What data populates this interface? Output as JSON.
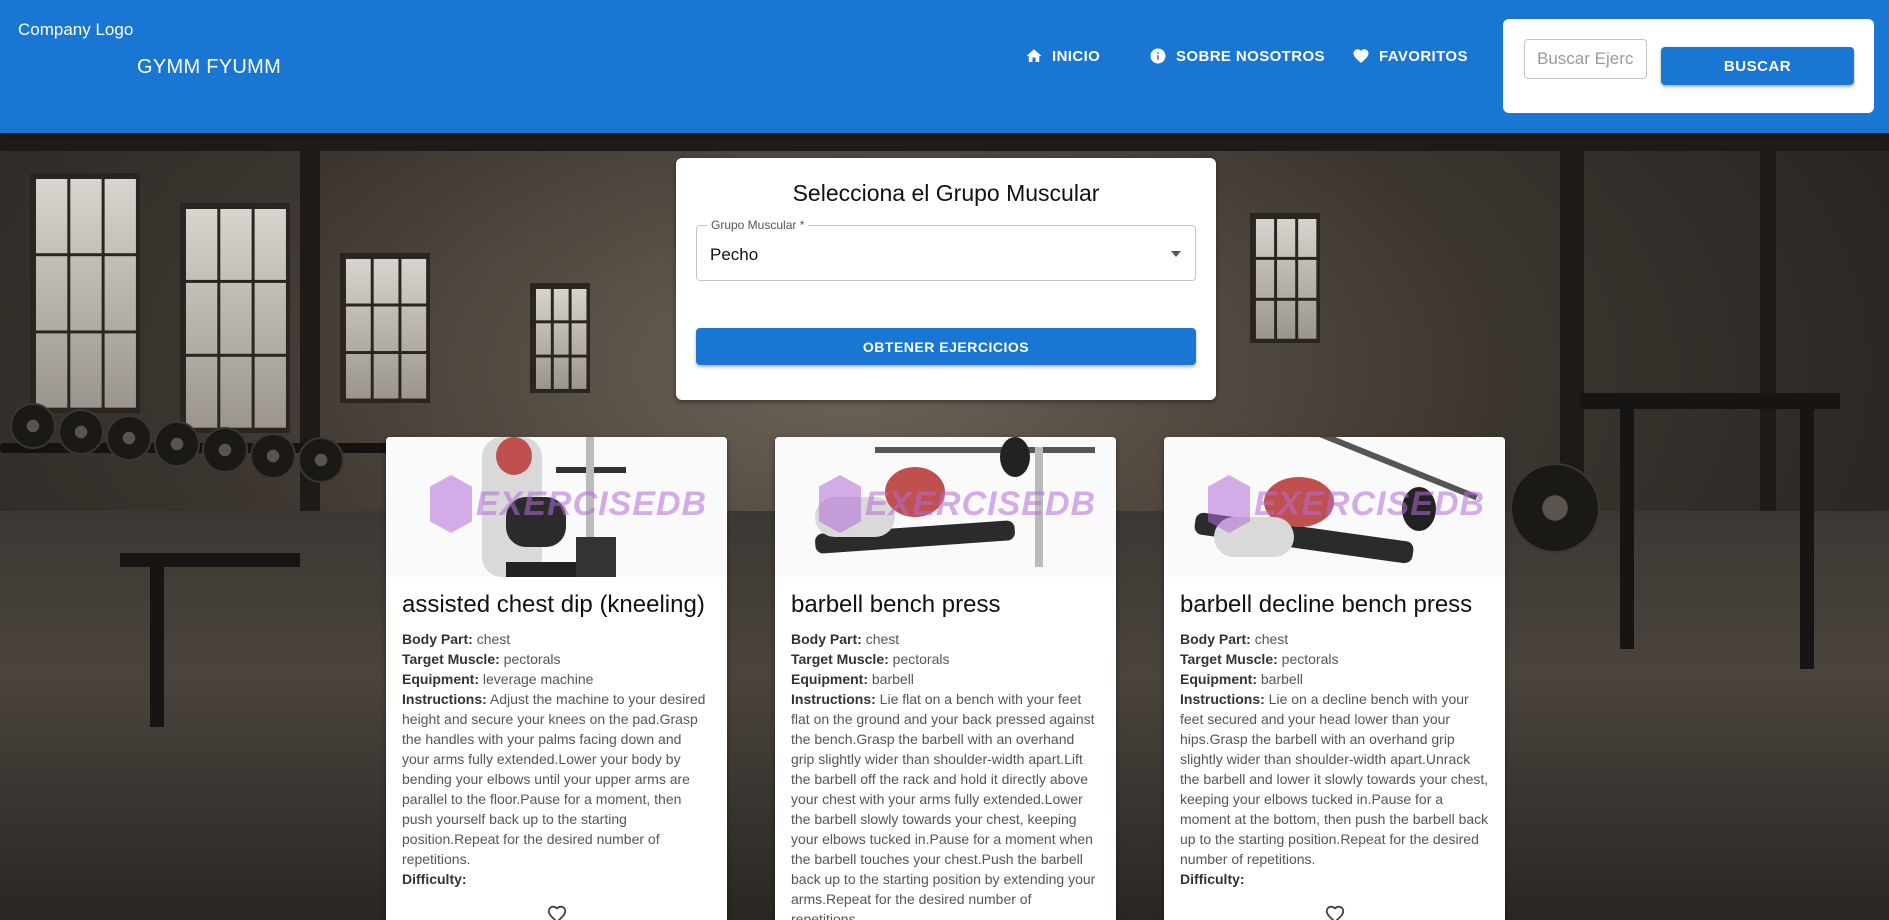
{
  "header": {
    "company_logo": "Company Logo",
    "brand": "GYMM FYUMM",
    "nav": [
      {
        "label": "INICIO",
        "icon": "home-icon"
      },
      {
        "label": "SOBRE NOSOTROS",
        "icon": "info-icon"
      },
      {
        "label": "FAVORITOS",
        "icon": "heart-icon"
      }
    ],
    "search": {
      "placeholder": "Buscar Ejercicio",
      "value": "",
      "button_label": "BUSCAR"
    }
  },
  "selector": {
    "title": "Selecciona el Grupo Muscular",
    "field_label": "Grupo Muscular *",
    "selected": "Pecho",
    "button_label": "OBTENER EJERCICIOS"
  },
  "watermark": "EXERCISEDB",
  "labels": {
    "body_part": "Body Part:",
    "target": "Target Muscle:",
    "equipment": "Equipment:",
    "instructions": "Instructions:",
    "difficulty": "Difficulty:"
  },
  "exercises": [
    {
      "name": "assisted chest dip (kneeling)",
      "body_part": "chest",
      "target": "pectorals",
      "equipment": "leverage machine",
      "instructions": "Adjust the machine to your desired height and secure your knees on the pad.Grasp the handles with your palms facing down and your arms fully extended.Lower your body by bending your elbows until your upper arms are parallel to the floor.Pause for a moment, then push yourself back up to the starting position.Repeat for the desired number of repetitions.",
      "difficulty": ""
    },
    {
      "name": "barbell bench press",
      "body_part": "chest",
      "target": "pectorals",
      "equipment": "barbell",
      "instructions": "Lie flat on a bench with your feet flat on the ground and your back pressed against the bench.Grasp the barbell with an overhand grip slightly wider than shoulder-width apart.Lift the barbell off the rack and hold it directly above your chest with your arms fully extended.Lower the barbell slowly towards your chest, keeping your elbows tucked in.Pause for a moment when the barbell touches your chest.Push the barbell back up to the starting position by extending your arms.Repeat for the desired number of repetitions.",
      "difficulty": ""
    },
    {
      "name": "barbell decline bench press",
      "body_part": "chest",
      "target": "pectorals",
      "equipment": "barbell",
      "instructions": "Lie on a decline bench with your feet secured and your head lower than your hips.Grasp the barbell with an overhand grip slightly wider than shoulder-width apart.Unrack the barbell and lower it slowly towards your chest, keeping your elbows tucked in.Pause for a moment at the bottom, then push the barbell back up to the starting position.Repeat for the desired number of repetitions.",
      "difficulty": ""
    }
  ]
}
